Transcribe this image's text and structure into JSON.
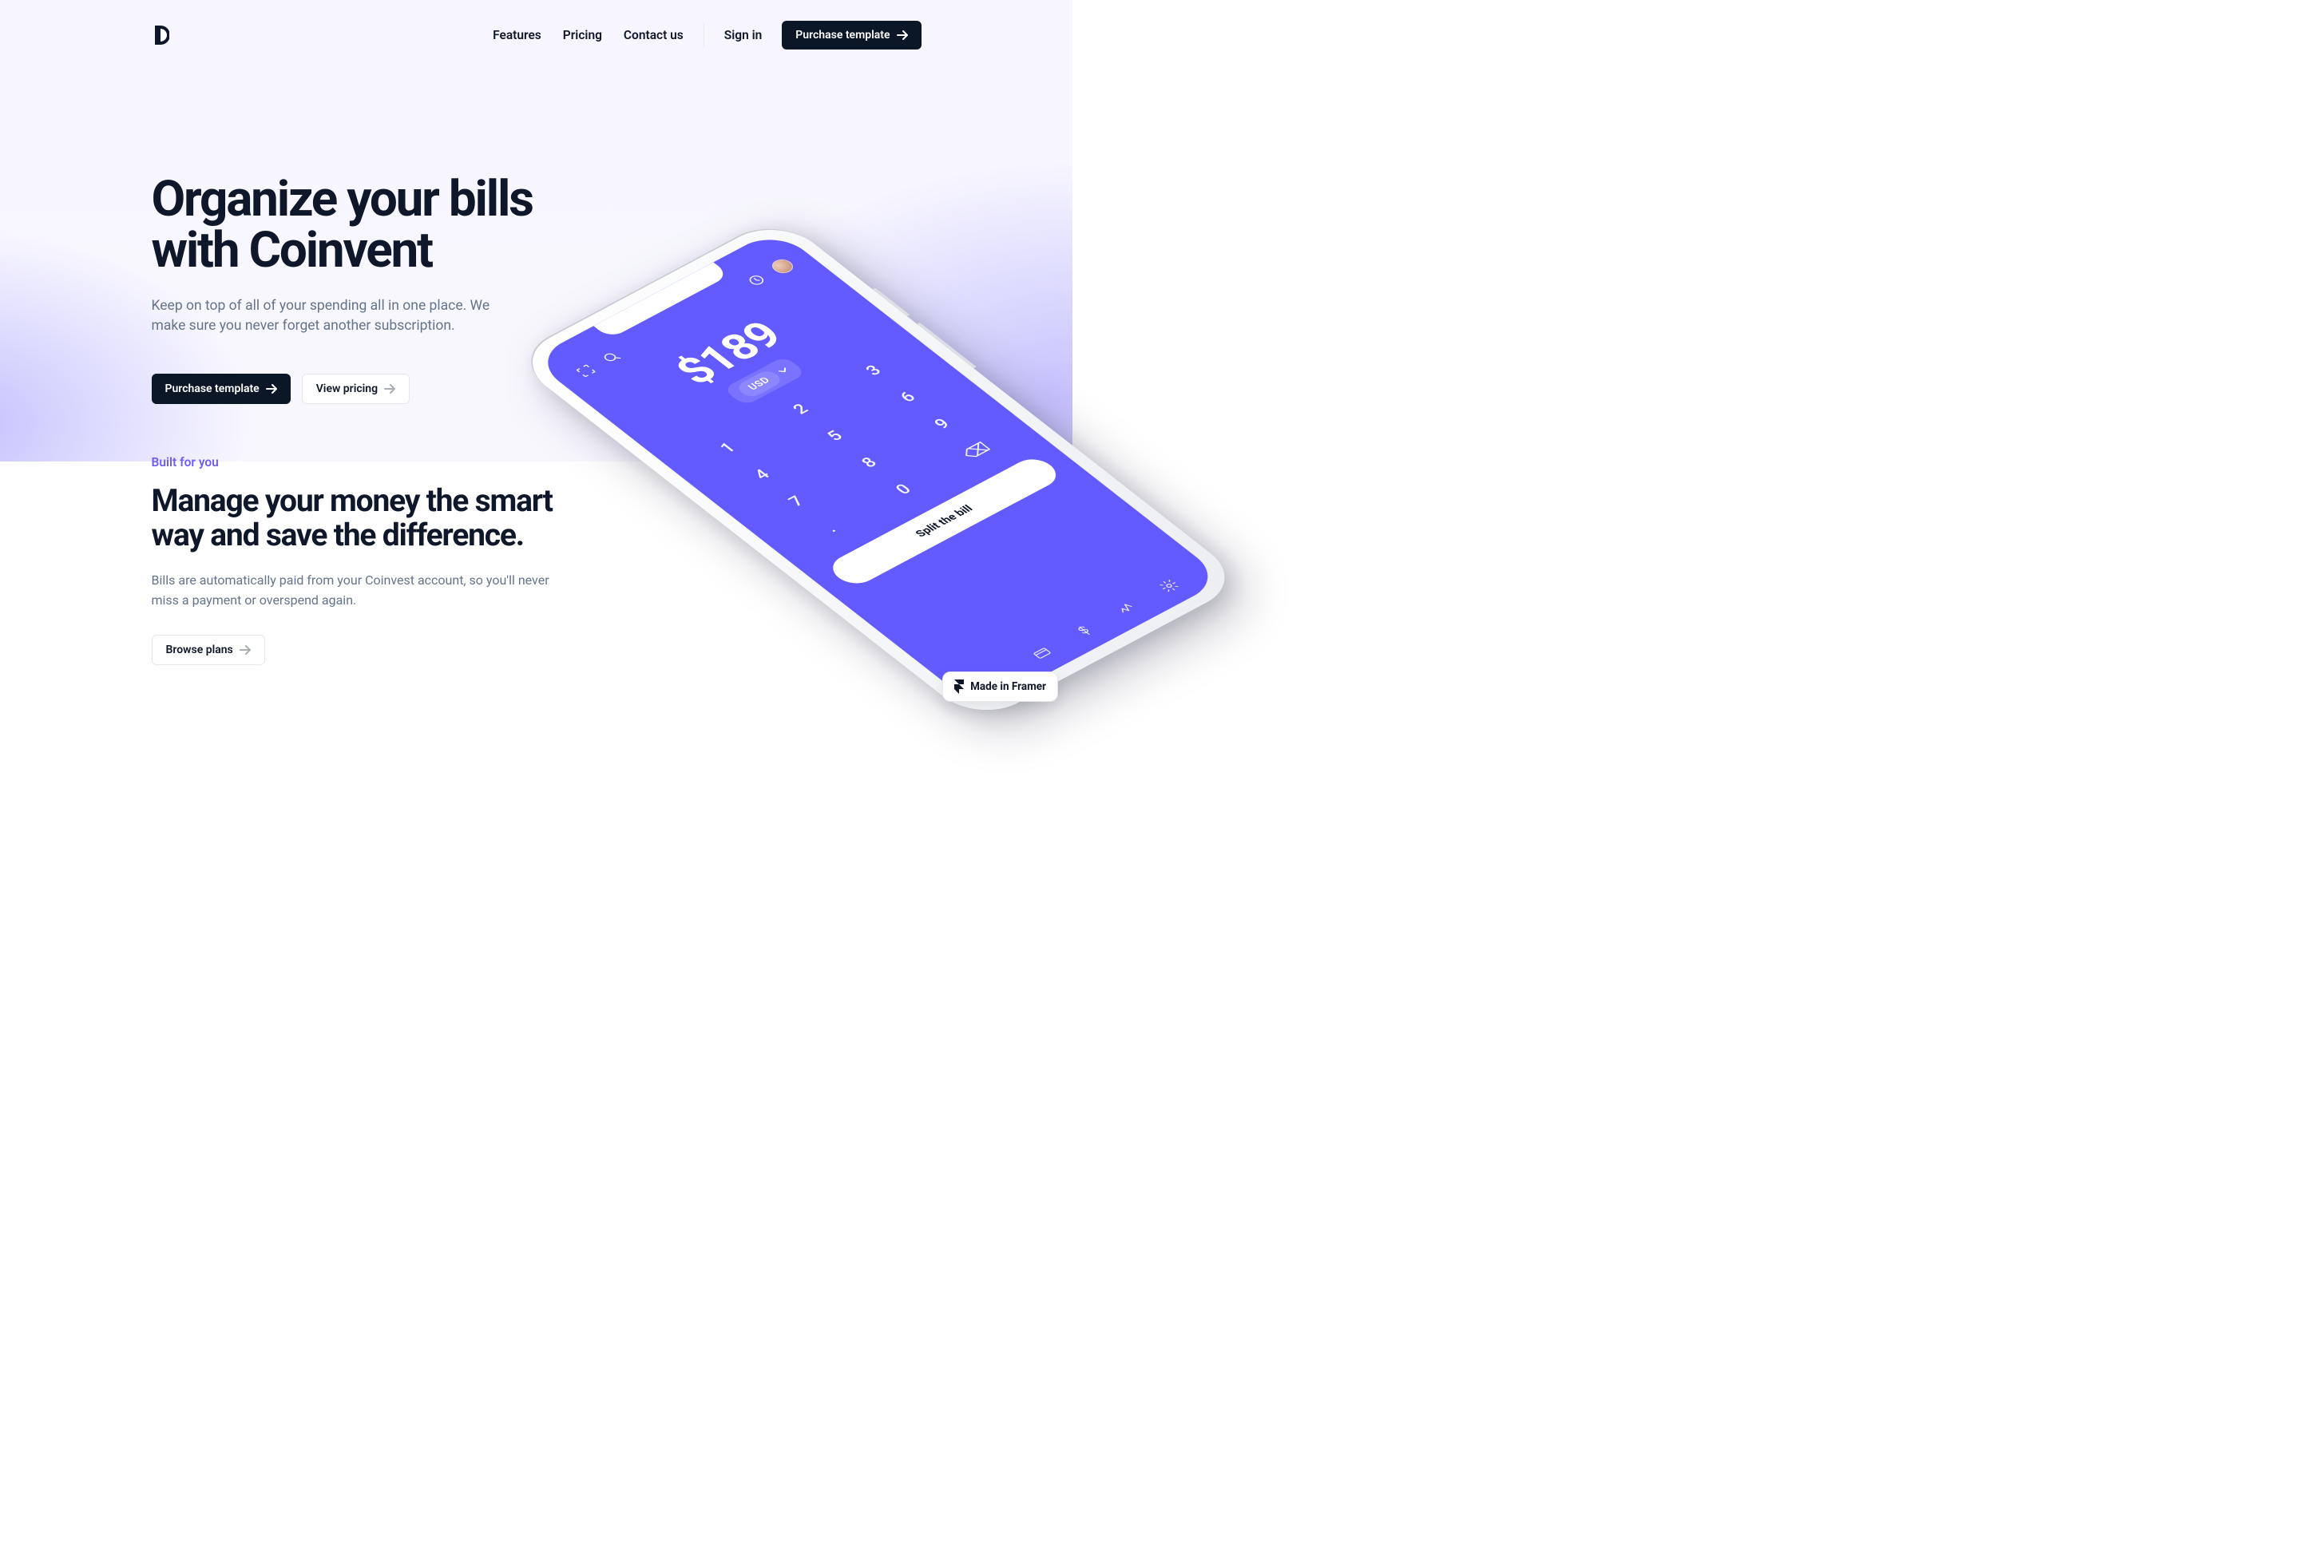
{
  "nav": {
    "links": [
      {
        "label": "Features"
      },
      {
        "label": "Pricing"
      },
      {
        "label": "Contact us"
      }
    ],
    "sign_in": "Sign in",
    "purchase": "Purchase template"
  },
  "hero": {
    "title_line1": "Organize your bills",
    "title_line2": "with Coinvent",
    "subtitle": "Keep on top of all of your spending all in one place. We make sure you never forget another subscription.",
    "cta_primary": "Purchase template",
    "cta_secondary": "View pricing"
  },
  "phone": {
    "amount": "$189",
    "currency": "USD",
    "keypad": [
      "1",
      "2",
      "3",
      "4",
      "5",
      "6",
      "7",
      "8",
      "9",
      ".",
      "0",
      "⌫"
    ],
    "split": "Split the bill"
  },
  "section2": {
    "eyebrow": "Built for you",
    "title": "Manage your money the smart way and save the difference.",
    "subtitle": "Bills are automatically paid from your Coinvest account, so you'll never miss a payment or overspend again.",
    "cta": "Browse plans"
  },
  "badge": {
    "label": "Made in Framer"
  },
  "colors": {
    "accent": "#635BFF",
    "dark": "#0B1727",
    "text": "#0F172A",
    "muted": "#64748B"
  }
}
